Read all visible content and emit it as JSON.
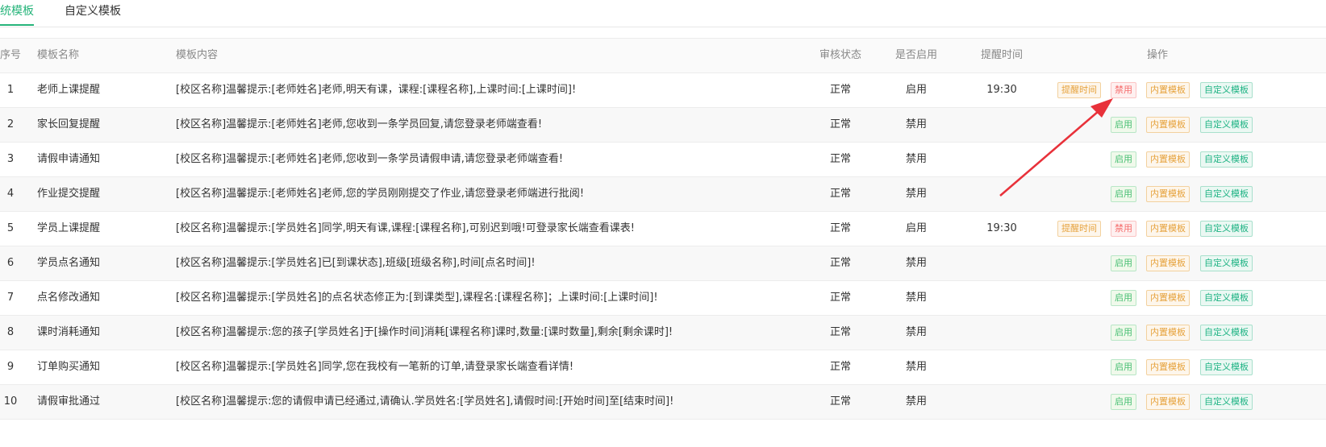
{
  "tabs": [
    {
      "label": "统模板",
      "active": true
    },
    {
      "label": "自定义模板",
      "active": false
    }
  ],
  "columns": {
    "index": "序号",
    "name": "模板名称",
    "content": "模板内容",
    "audit": "审核状态",
    "enabled": "是否启用",
    "time": "提醒时间",
    "ops": "操作"
  },
  "action_labels": {
    "remind": "提醒时间",
    "disable": "禁用",
    "enable": "启用",
    "builtin": "内置模板",
    "custom": "自定义模板"
  },
  "rows": [
    {
      "index": "1",
      "name": "老师上课提醒",
      "content": "[校区名称]温馨提示:[老师姓名]老师,明天有课，课程:[课程名称],上课时间:[上课时间]!",
      "audit": "正常",
      "enabled": "启用",
      "time": "19:30"
    },
    {
      "index": "2",
      "name": "家长回复提醒",
      "content": "[校区名称]温馨提示:[老师姓名]老师,您收到一条学员回复,请您登录老师端查看!",
      "audit": "正常",
      "enabled": "禁用",
      "time": ""
    },
    {
      "index": "3",
      "name": "请假申请通知",
      "content": "[校区名称]温馨提示:[老师姓名]老师,您收到一条学员请假申请,请您登录老师端查看!",
      "audit": "正常",
      "enabled": "禁用",
      "time": ""
    },
    {
      "index": "4",
      "name": "作业提交提醒",
      "content": "[校区名称]温馨提示:[老师姓名]老师,您的学员刚刚提交了作业,请您登录老师端进行批阅!",
      "audit": "正常",
      "enabled": "禁用",
      "time": ""
    },
    {
      "index": "5",
      "name": "学员上课提醒",
      "content": "[校区名称]温馨提示:[学员姓名]同学,明天有课,课程:[课程名称],可别迟到哦!可登录家长端查看课表!",
      "audit": "正常",
      "enabled": "启用",
      "time": "19:30"
    },
    {
      "index": "6",
      "name": "学员点名通知",
      "content": "[校区名称]温馨提示:[学员姓名]已[到课状态],班级[班级名称],时间[点名时间]!",
      "audit": "正常",
      "enabled": "禁用",
      "time": ""
    },
    {
      "index": "7",
      "name": "点名修改通知",
      "content": "[校区名称]温馨提示:[学员姓名]的点名状态修正为:[到课类型],课程名:[课程名称]；上课时间:[上课时间]!",
      "audit": "正常",
      "enabled": "禁用",
      "time": ""
    },
    {
      "index": "8",
      "name": "课时消耗通知",
      "content": "[校区名称]温馨提示:您的孩子[学员姓名]于[操作时间]消耗[课程名称]课时,数量:[课时数量],剩余[剩余课时]!",
      "audit": "正常",
      "enabled": "禁用",
      "time": ""
    },
    {
      "index": "9",
      "name": "订单购买通知",
      "content": "[校区名称]温馨提示:[学员姓名]同学,您在我校有一笔新的订单,请登录家长端查看详情!",
      "audit": "正常",
      "enabled": "禁用",
      "time": ""
    },
    {
      "index": "10",
      "name": "请假审批通过",
      "content": "[校区名称]温馨提示:您的请假申请已经通过,请确认.学员姓名:[学员姓名],请假时间:[开始时间]至[结束时间]!",
      "audit": "正常",
      "enabled": "禁用",
      "time": ""
    }
  ],
  "colors": {
    "accent": "#26b47a",
    "arrow": "#e8313a"
  }
}
